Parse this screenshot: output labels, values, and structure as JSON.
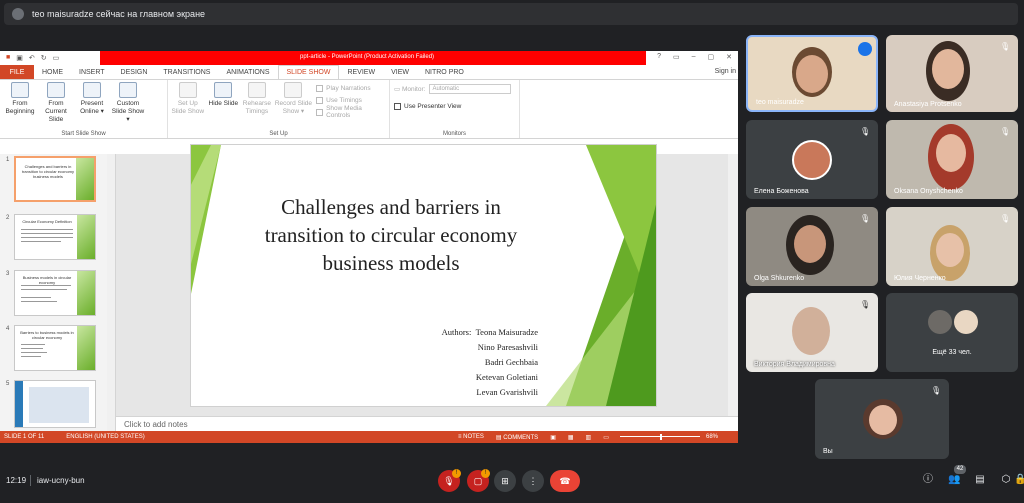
{
  "banner": {
    "text": "teo maisuradze сейчас на главном экране"
  },
  "ppt": {
    "window_title": "ppt-article - PowerPoint (Product Activation Failed)",
    "sign_in": "Sign in",
    "tabs": [
      "FILE",
      "HOME",
      "INSERT",
      "DESIGN",
      "TRANSITIONS",
      "ANIMATIONS",
      "SLIDE SHOW",
      "REVIEW",
      "VIEW",
      "NITRO PRO"
    ],
    "active_tab": "SLIDE SHOW",
    "ribbon": {
      "start": {
        "label": "Start Slide Show",
        "btn1": "From Beginning",
        "btn2": "From Current Slide",
        "btn3": "Present Online ▾",
        "btn4": "Custom Slide Show ▾"
      },
      "setup": {
        "label": "Set Up",
        "btn1": "Set Up Slide Show",
        "btn2": "Hide Slide",
        "btn3": "Rehearse Timings",
        "btn4": "Record Slide Show ▾",
        "chk1": "Play Narrations",
        "chk2": "Use Timings",
        "chk3": "Show Media Controls"
      },
      "monitors": {
        "label": "Monitors",
        "monitor_label": "Monitor:",
        "monitor_value": "Automatic",
        "presenter": "Use Presenter View"
      }
    },
    "thumbs": [
      {
        "num": "1",
        "title": "Challenges and barriers in transition to circular economy business models"
      },
      {
        "num": "2",
        "title": "Circular Economy Definition"
      },
      {
        "num": "3",
        "title": "Business models in circular economy"
      },
      {
        "num": "4",
        "title": "Barriers to business models in circular economy"
      },
      {
        "num": "5",
        "title": ""
      }
    ],
    "slide": {
      "title": "Challenges and barriers in transition to circular economy business models",
      "authors_label": "Authors:",
      "authors": [
        "Teona Maisuradze",
        "Nino Paresashvili",
        "Badri Gechbaia",
        "Ketevan Goletiani",
        "Levan Gvarishvili"
      ]
    },
    "notes_placeholder": "Click to add notes",
    "status": {
      "slide": "SLIDE 1 OF 11",
      "lang": "ENGLISH (UNITED STATES)",
      "notes": "NOTES",
      "comments": "COMMENTS",
      "zoom": "68%"
    },
    "colors": {
      "accent": "#d24726",
      "red_bar": "#ff0000",
      "green": "#6aae2a"
    }
  },
  "participants": [
    {
      "name": "teo maisuradze",
      "speaking": true
    },
    {
      "name": "Anastasiya Protsenko",
      "muted": true
    },
    {
      "name": "Елена Боженова",
      "muted": true
    },
    {
      "name": "Oksana Onyshchenko",
      "muted": true
    },
    {
      "name": "Olga Shkurenko",
      "muted": true
    },
    {
      "name": "Юлия Черненко",
      "muted": true
    },
    {
      "name": "Виктория Владимировна",
      "muted": true
    },
    {
      "name": "Ещё 33 чел."
    },
    {
      "name": "Вы",
      "muted": true
    }
  ],
  "bottom": {
    "time": "12:19",
    "meeting_code": "iaw-ucny-bun",
    "people_count": "42"
  },
  "icons": [
    "mic-off-icon",
    "camera-off-icon",
    "present-icon",
    "more-icon",
    "hangup-icon",
    "info-icon",
    "people-icon",
    "chat-icon",
    "activities-icon",
    "lock-icon"
  ]
}
